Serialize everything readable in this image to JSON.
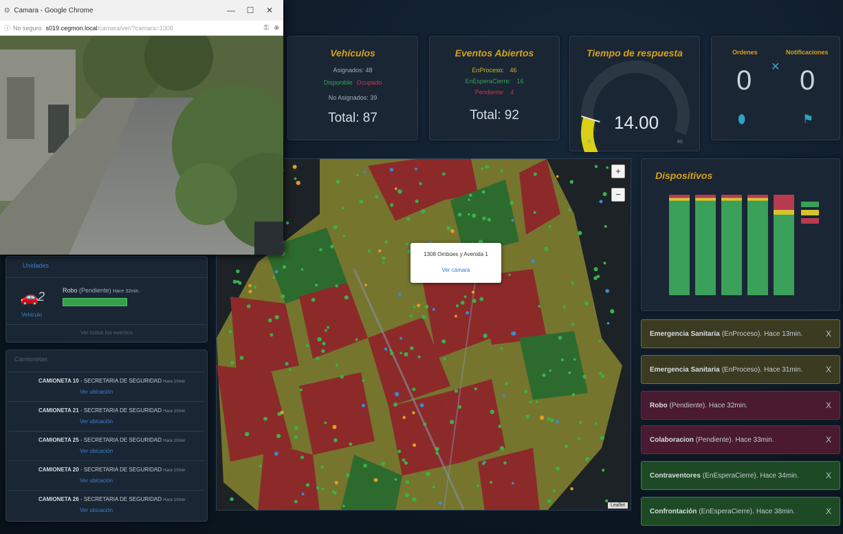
{
  "browser": {
    "title": "Camara - Google Chrome",
    "not_secure": "No seguro",
    "host": "s019.cegmon.local",
    "path": "/camara/ver/?camara=1308"
  },
  "vehicles": {
    "title": "Vehículos",
    "assigned": "Asignados: 48",
    "available": "Disponible",
    "busy": "Ocupado",
    "not_assigned": "No Asignados: 39",
    "total": "Total: 87"
  },
  "events": {
    "title": "Eventos Abiertos",
    "in_process_label": "EnProceso:",
    "in_process_value": "46",
    "waiting_label": "EnEsperaCierre:",
    "waiting_value": "16",
    "pending_label": "Pendiente:",
    "pending_value": "4",
    "total": "Total: 92"
  },
  "response": {
    "title": "Tiempo de respuesta",
    "value": "14.00",
    "min": "0",
    "max": "60",
    "gauge_fraction": 0.23
  },
  "orders": {
    "orders_label": "Ordenes",
    "notif_label": "Notificaciones",
    "orders_count": "0",
    "notif_count": "0"
  },
  "left_panel": {
    "header": "Unidades",
    "vehicle_count": "2",
    "unit_link": "Vehiculo",
    "event_title": "Robo",
    "event_status": "(Pendiente)",
    "event_time": "Hace 32min.",
    "footer": "Ver todos los eventos",
    "list_header": "Camionetas"
  },
  "units": [
    {
      "name": "CAMIONETA 10",
      "org": " - SECRETARIA DE SEGURIDAD",
      "time": "Hace 10min",
      "link": "Ver ubicación"
    },
    {
      "name": "CAMIONETA 21",
      "org": " - SECRETARIA DE SEGURIDAD",
      "time": "Hace 10min",
      "link": "Ver ubicación"
    },
    {
      "name": "CAMIONETA 25",
      "org": " - SECRETARIA DE SEGURIDAD",
      "time": "Hace 10min",
      "link": "Ver ubicación"
    },
    {
      "name": "CAMIONETA 20",
      "org": " - SECRETARIA DE SEGURIDAD",
      "time": "Hace 10min",
      "link": "Ver ubicación"
    },
    {
      "name": "CAMIONETA 26",
      "org": " - SECRETARIA DE SEGURIDAD",
      "time": "Hace 10min",
      "link": "Ver ubicación"
    }
  ],
  "map": {
    "popup_title": "1308 Ombúes y Avenida 1",
    "popup_link": "Ver cámara",
    "zoom_in": "+",
    "zoom_out": "−",
    "attribution": "Leaflet"
  },
  "devices": {
    "title": "Dispositivos",
    "legend_colors": [
      "#3aa05a",
      "#d6c234",
      "#b83a4f"
    ]
  },
  "chart_data": {
    "type": "bar",
    "categories": [
      "",
      "",
      "",
      "",
      ""
    ],
    "series": [
      {
        "values": [
          94,
          94,
          94,
          94,
          80
        ],
        "color": "#3aa05a"
      },
      {
        "values": [
          3,
          3,
          3,
          3,
          5
        ],
        "color": "#d6c234"
      },
      {
        "values": [
          3,
          3,
          3,
          3,
          15
        ],
        "color": "#b83a4f"
      }
    ],
    "stacked": true,
    "ylim": [
      0,
      100
    ]
  },
  "notifications": [
    {
      "title": "Emergencia Sanitaria",
      "status": "(EnProceso).",
      "time": "Hace 13min.",
      "variant": "yellow"
    },
    {
      "title": "Emergencia Sanitaria",
      "status": "(EnProceso).",
      "time": "Hace 31min.",
      "variant": "yellow"
    },
    {
      "title": "Robo",
      "status": "(Pendiente).",
      "time": "Hace 32min.",
      "variant": "red"
    },
    {
      "title": "Colaboracion",
      "status": "(Pendiente).",
      "time": "Hace 33min.",
      "variant": "red"
    },
    {
      "title": "Contraventores",
      "status": "(EnEsperaCierre).",
      "time": "Hace 34min.",
      "variant": "green"
    },
    {
      "title": "Confrontación",
      "status": "(EnEsperaCierre).",
      "time": "Hace 38min.",
      "variant": "green"
    }
  ],
  "close_glyph": "X"
}
